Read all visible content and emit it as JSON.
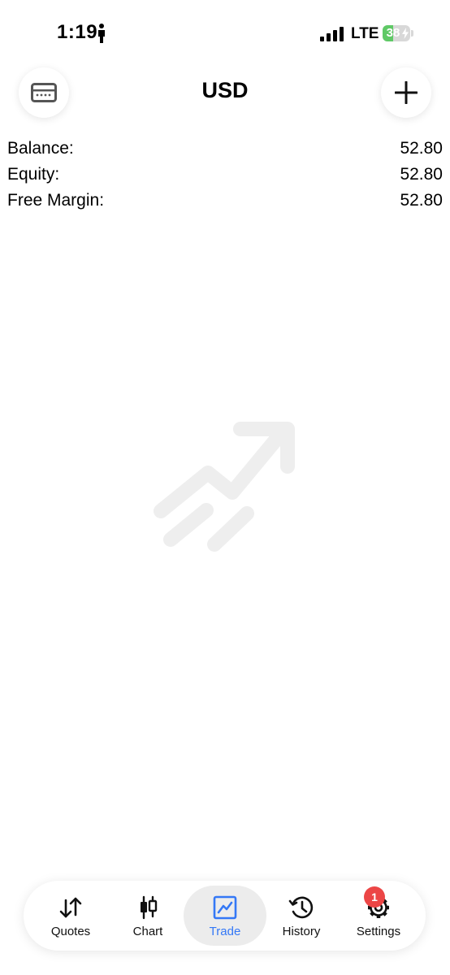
{
  "status_bar": {
    "time": "1:19",
    "network": "LTE",
    "battery_level": "38",
    "battery_fraction": 0.38,
    "icons": [
      "person-icon",
      "signal-icon",
      "battery-icon",
      "charging-bolt-icon"
    ]
  },
  "header": {
    "title": "USD",
    "left_icon": "credit-card-icon",
    "right_icon": "plus-icon"
  },
  "account": {
    "rows": [
      {
        "label": "Balance:",
        "value": "52.80"
      },
      {
        "label": "Equity:",
        "value": "52.80"
      },
      {
        "label": "Free Margin:",
        "value": "52.80"
      }
    ]
  },
  "empty_state": {
    "icon": "trending-up-icon"
  },
  "tabs": [
    {
      "label": "Quotes",
      "icon": "arrows-up-down-icon",
      "active": false
    },
    {
      "label": "Chart",
      "icon": "candlestick-icon",
      "active": false
    },
    {
      "label": "Trade",
      "icon": "line-chart-icon",
      "active": true
    },
    {
      "label": "History",
      "icon": "history-icon",
      "active": false
    },
    {
      "label": "Settings",
      "icon": "gear-icon",
      "active": false,
      "badge": "1"
    }
  ],
  "colors": {
    "accent": "#3478f6",
    "badge": "#ec4646",
    "battery": "#5fc966",
    "illustration": "#eeeeee"
  }
}
